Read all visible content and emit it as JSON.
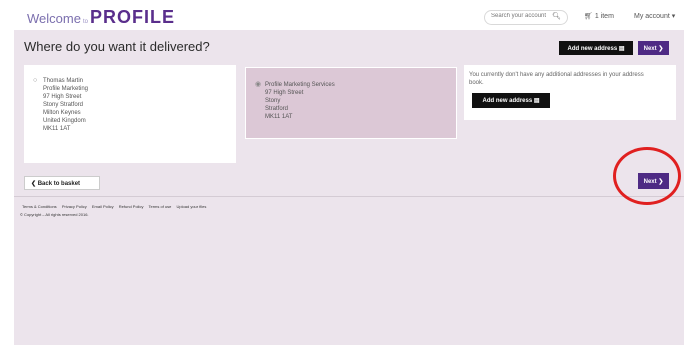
{
  "header": {
    "welcome": "Welcome",
    "to": "to",
    "logo": "PROFILE",
    "search_placeholder": "Search your account",
    "basket_label": "1 item",
    "account_label": "My account ▾"
  },
  "page": {
    "title": "Where do you want it delivered?",
    "add_address_label": "Add new address ▤",
    "next_label": "Next ❯",
    "no_addresses_text": "You currently don't have any additional addresses in your address book."
  },
  "addresses": [
    {
      "lines": [
        "Thomas Martin",
        "Profile Marketing",
        "97 High Street",
        "Stony Stratford",
        "Milton Keynes",
        "United Kingdom",
        "MK11 1AT"
      ]
    },
    {
      "lines": [
        "Profile Marketing Services",
        "97 High Street",
        "Stony",
        "Stratford",
        "MK11 1AT"
      ]
    }
  ],
  "actions": {
    "back_label": "❮ Back to basket",
    "next_bottom_label": "Next ❯"
  },
  "footer": {
    "links": [
      "Terms & Conditions",
      "Privacy Policy",
      "Email Policy",
      "Refund Policy",
      "Terms of use",
      "Upload your files"
    ],
    "copyright": "© Copyright – All rights reserved 2016."
  },
  "annotation_color": "#e02020"
}
